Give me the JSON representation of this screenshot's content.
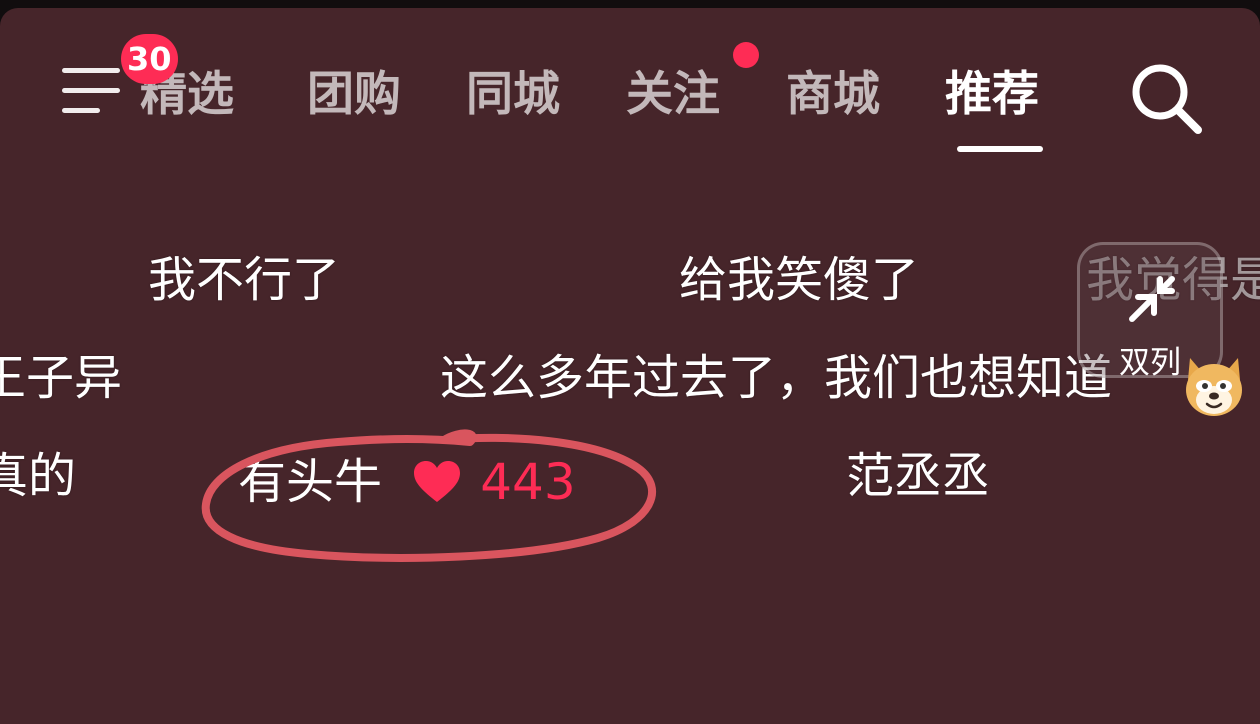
{
  "nav": {
    "menu_badge": "30",
    "tabs": [
      {
        "label": "精选",
        "active": false
      },
      {
        "label": "团购",
        "active": false
      },
      {
        "label": "同城",
        "active": false
      },
      {
        "label": "关注",
        "active": false,
        "has_dot": true
      },
      {
        "label": "商城",
        "active": false
      },
      {
        "label": "推荐",
        "active": true
      }
    ]
  },
  "danmaku": {
    "row1": [
      "我不行了",
      "给我笑傻了",
      "我觉得是"
    ],
    "row2": [
      "王子异",
      "这么多年过去了，我们也想知道"
    ],
    "row3": [
      "真的",
      "范丞丞"
    ],
    "own": {
      "name": "有头牛",
      "likes": "443"
    }
  },
  "layout_toggle": {
    "label": "双列"
  },
  "colors": {
    "background": "#46252a",
    "accent": "#fe2c55",
    "highlight_circle": "#d9555e"
  },
  "icons": [
    "menu-icon",
    "search-icon",
    "heart-icon",
    "expand-arrows-icon",
    "dog-emoji-icon"
  ]
}
